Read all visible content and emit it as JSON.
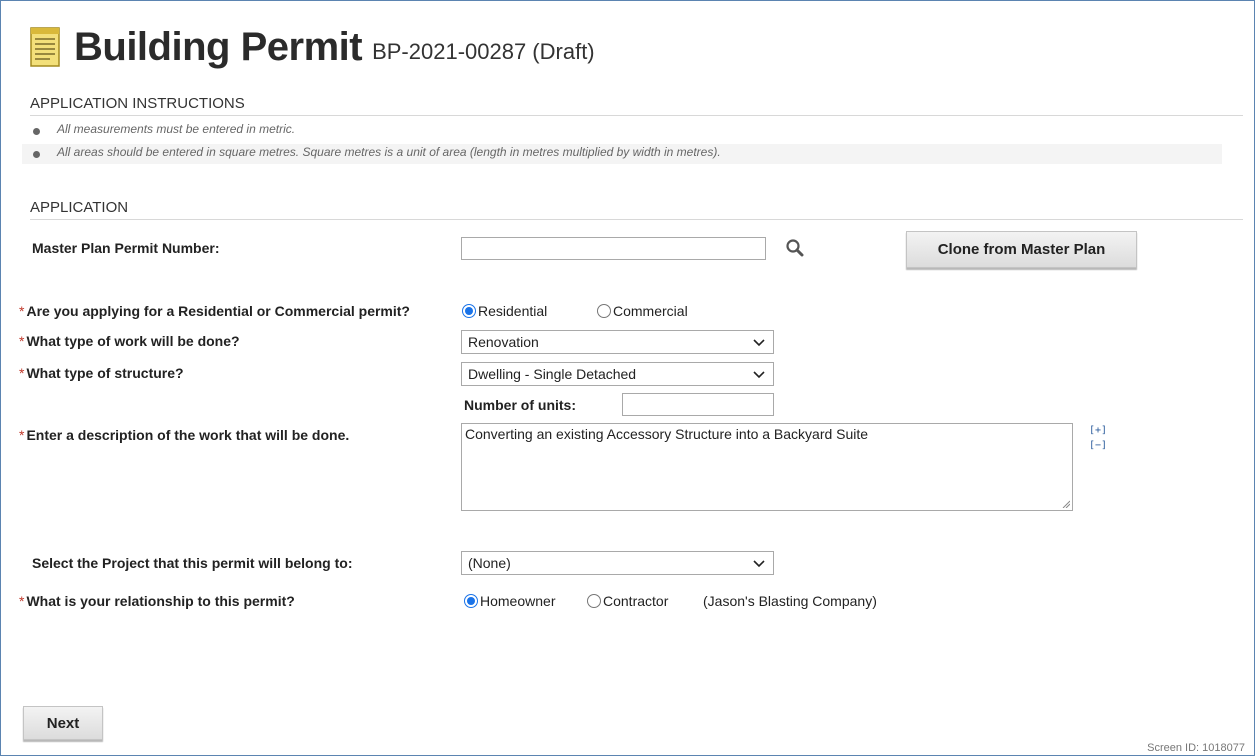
{
  "header": {
    "title": "Building Permit",
    "subtitle": "BP-2021-00287 (Draft)"
  },
  "instructions": {
    "heading": "APPLICATION INSTRUCTIONS",
    "items": [
      "All measurements must be entered in metric.",
      "All areas should be entered in square metres. Square metres is a unit of area (length in metres multiplied by width in metres)."
    ]
  },
  "application": {
    "heading": "APPLICATION",
    "master_plan": {
      "label": "Master Plan Permit Number:",
      "value": "",
      "clone_button": "Clone from Master Plan"
    },
    "permit_type": {
      "required_mark": "*",
      "label": "Are you applying for a Residential or Commercial permit?",
      "options": [
        "Residential",
        "Commercial"
      ],
      "selected": "Residential"
    },
    "work_type": {
      "required_mark": "*",
      "label": "What type of work will be done?",
      "value": "Renovation"
    },
    "structure_type": {
      "required_mark": "*",
      "label": "What type of structure?",
      "value": "Dwelling - Single Detached",
      "units_label": "Number of units:",
      "units_value": ""
    },
    "description": {
      "required_mark": "*",
      "label": "Enter a description of the work that will be done.",
      "value": "Converting an existing Accessory Structure into a Backyard Suite",
      "expand": "[+]",
      "collapse": "[−]"
    },
    "project": {
      "label": "Select the Project that this permit will belong to:",
      "value": "(None)"
    },
    "relationship": {
      "required_mark": "*",
      "label": "What is your relationship to this permit?",
      "options": [
        "Homeowner",
        "Contractor"
      ],
      "selected": "Homeowner",
      "contractor_name": "(Jason's Blasting Company)"
    }
  },
  "footer": {
    "next_button": "Next",
    "screen_id": "Screen ID: 1018077"
  },
  "colors": {
    "accent": "#1a73e8",
    "required": "#c0392b",
    "frame": "#5b84b1"
  }
}
